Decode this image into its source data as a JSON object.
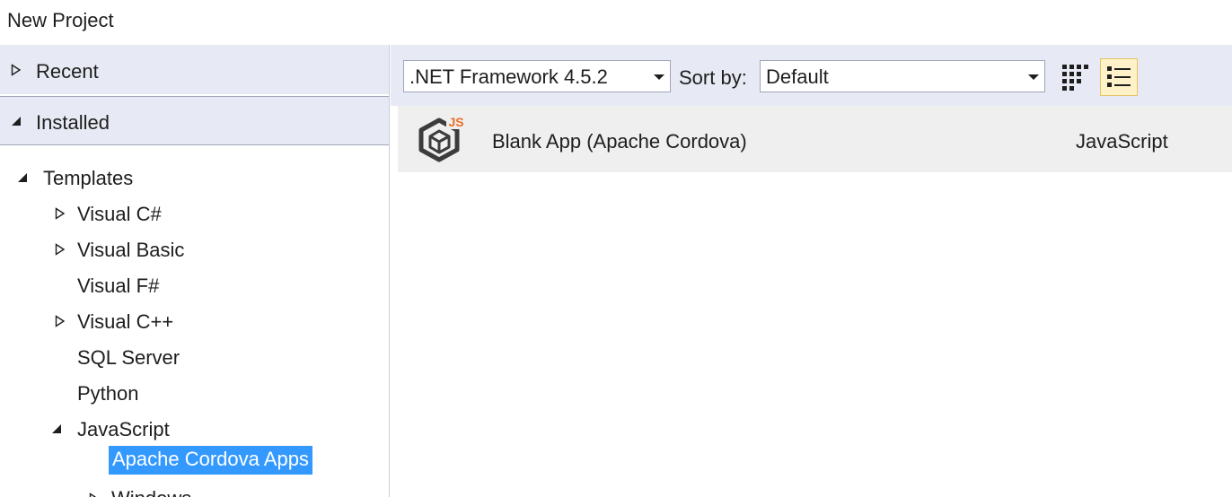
{
  "window": {
    "title": "New Project"
  },
  "sidebar": {
    "recent_label": "Recent",
    "installed_label": "Installed",
    "templates": {
      "label": "Templates",
      "items": [
        {
          "label": "Visual C#",
          "expandable": true
        },
        {
          "label": "Visual Basic",
          "expandable": true
        },
        {
          "label": "Visual F#",
          "expandable": false
        },
        {
          "label": "Visual C++",
          "expandable": true
        },
        {
          "label": "SQL Server",
          "expandable": false
        },
        {
          "label": "Python",
          "expandable": false
        },
        {
          "label": "JavaScript",
          "expanded": true
        },
        {
          "label": "Apache Cordova Apps",
          "selected": true
        },
        {
          "label": "Windows",
          "expandable": true
        }
      ]
    }
  },
  "toolbar": {
    "framework_select": ".NET Framework 4.5.2",
    "sort_label": "Sort by:",
    "sort_select": "Default"
  },
  "results": [
    {
      "name": "Blank App (Apache Cordova)",
      "language": "JavaScript",
      "icon": "cordova-js-icon"
    }
  ],
  "colors": {
    "accent": "#3399ff",
    "panel_bg": "#e7eaf4",
    "row_bg": "#efefef",
    "js_badge": "#e8702a",
    "active_view_bg": "#fff2c8"
  }
}
